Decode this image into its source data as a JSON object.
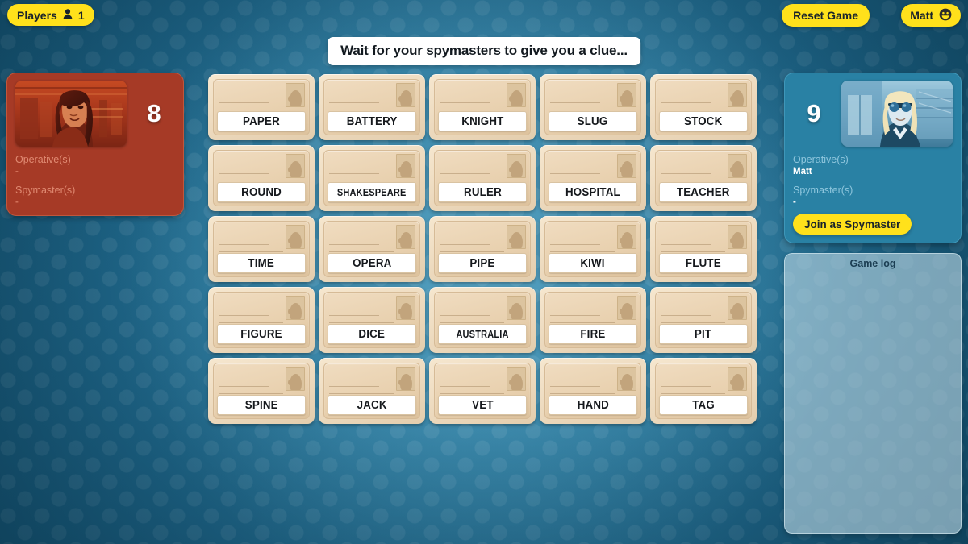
{
  "topbar": {
    "players_label": "Players",
    "players_icon": "person-icon",
    "players_count": "1",
    "reset_label": "Reset Game",
    "user_name": "Matt",
    "user_icon": "smiley-face-icon"
  },
  "banner": {
    "text": "Wait for your spymasters to give you a clue..."
  },
  "teams": {
    "red": {
      "score": "8",
      "color": "#a63a26",
      "avatar_alt": "red-team-agent-portrait",
      "operatives_label": "Operative(s)",
      "operatives_value": "-",
      "spymasters_label": "Spymaster(s)",
      "spymasters_value": "-"
    },
    "blue": {
      "score": "9",
      "color": "#2981a4",
      "avatar_alt": "blue-team-agent-portrait",
      "operatives_label": "Operative(s)",
      "operatives_value": "Matt",
      "spymasters_label": "Spymaster(s)",
      "spymasters_value": "-",
      "join_label": "Join as Spymaster"
    }
  },
  "game_log": {
    "title": "Game log",
    "entries": []
  },
  "board": {
    "rows": 5,
    "cols": 5,
    "cards": [
      {
        "word": "PAPER"
      },
      {
        "word": "BATTERY"
      },
      {
        "word": "KNIGHT"
      },
      {
        "word": "SLUG"
      },
      {
        "word": "STOCK"
      },
      {
        "word": "ROUND"
      },
      {
        "word": "SHAKESPEARE"
      },
      {
        "word": "RULER"
      },
      {
        "word": "HOSPITAL"
      },
      {
        "word": "TEACHER"
      },
      {
        "word": "TIME"
      },
      {
        "word": "OPERA"
      },
      {
        "word": "PIPE"
      },
      {
        "word": "KIWI"
      },
      {
        "word": "FLUTE"
      },
      {
        "word": "FIGURE"
      },
      {
        "word": "DICE"
      },
      {
        "word": "AUSTRALIA"
      },
      {
        "word": "FIRE"
      },
      {
        "word": "PIT"
      },
      {
        "word": "SPINE"
      },
      {
        "word": "JACK"
      },
      {
        "word": "VET"
      },
      {
        "word": "HAND"
      },
      {
        "word": "TAG"
      }
    ]
  },
  "colors": {
    "accent_yellow": "#ffe11b",
    "background_blue": "#2e7a9c",
    "red_team": "#a63a26",
    "blue_team": "#2981a4"
  }
}
